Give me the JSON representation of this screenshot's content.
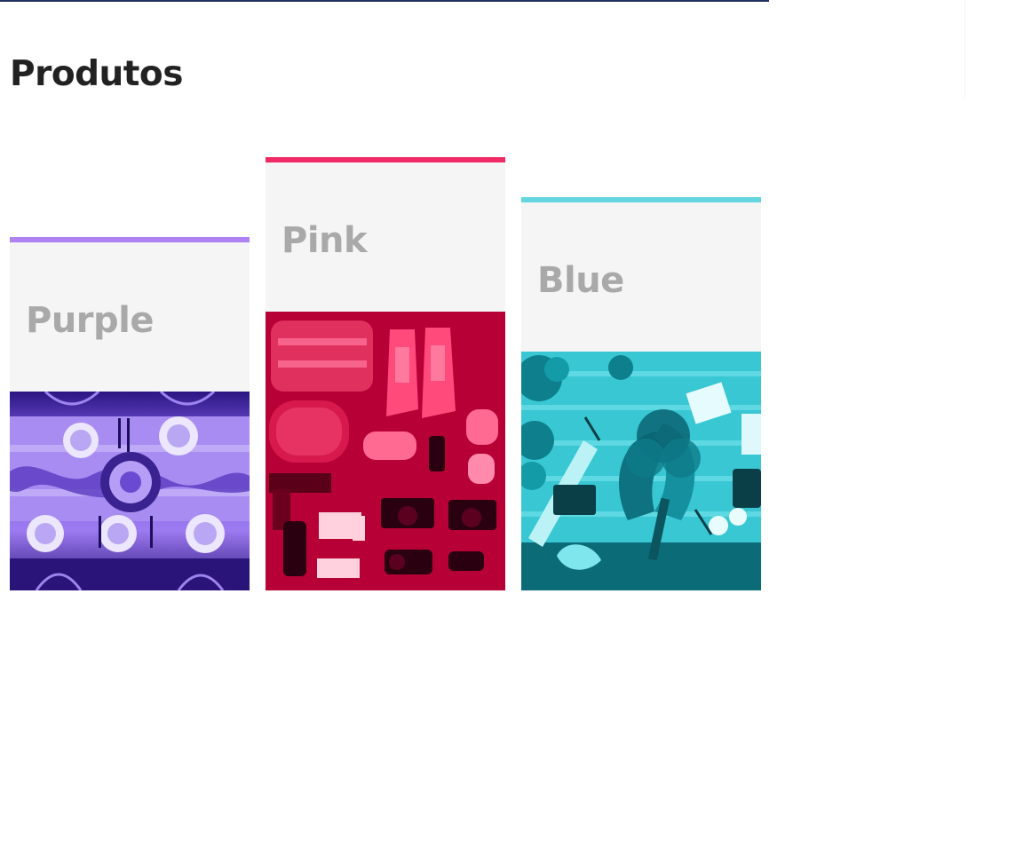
{
  "page": {
    "title": "Produtos"
  },
  "products": [
    {
      "label": "Purple",
      "accent_color": "#b083f5",
      "image": {
        "icon": "dining-table-photo",
        "tint": "#5b2fc9"
      }
    },
    {
      "label": "Pink",
      "accent_color": "#ef2a66",
      "image": {
        "icon": "travel-gear-photo",
        "tint": "#d0003c"
      }
    },
    {
      "label": "Blue",
      "accent_color": "#64d6e0",
      "image": {
        "icon": "flower-desk-photo",
        "tint": "#17b9c7"
      }
    }
  ]
}
